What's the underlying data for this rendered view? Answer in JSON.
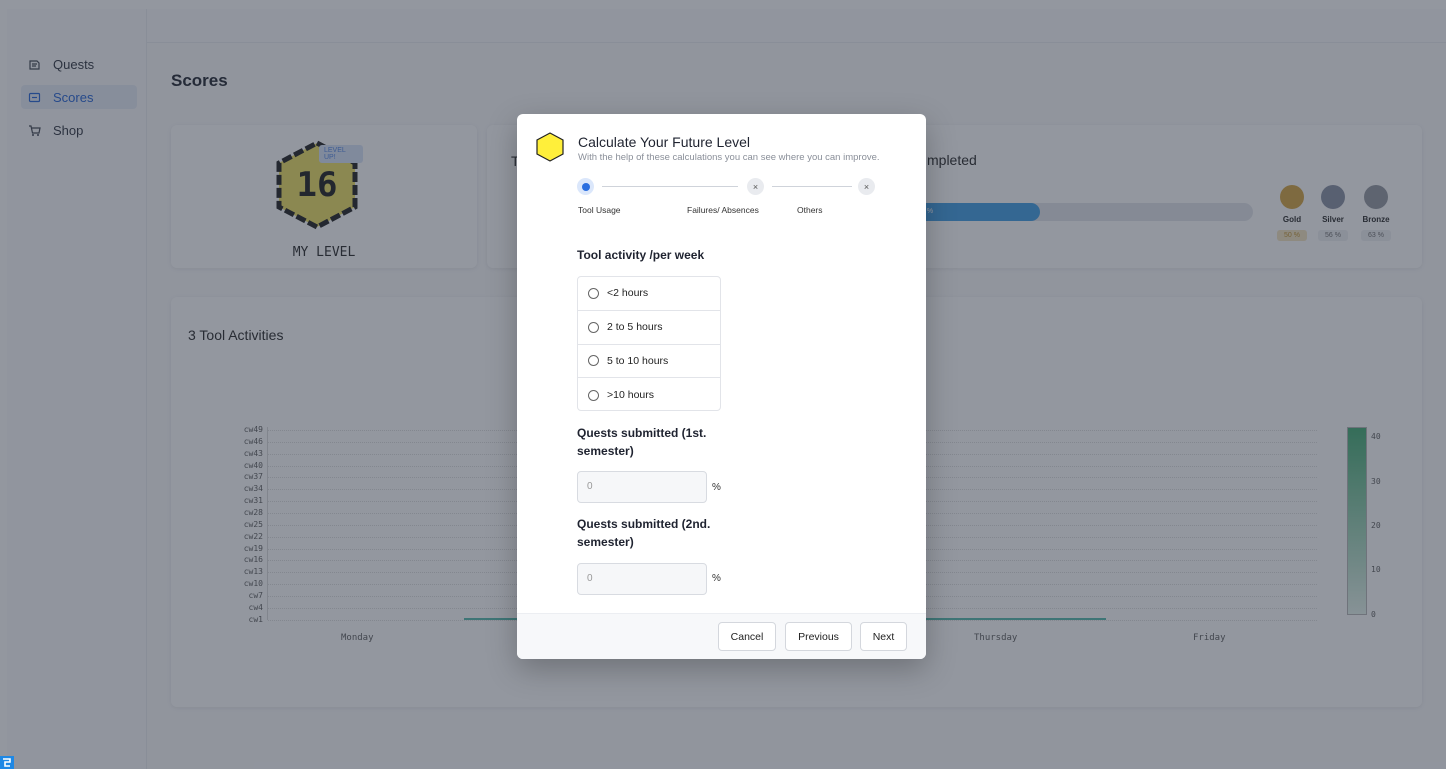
{
  "sidebar": {
    "items": [
      {
        "label": "Quests",
        "icon": "quest-icon"
      },
      {
        "label": "Scores",
        "icon": "scores-icon",
        "active": true
      },
      {
        "label": "Shop",
        "icon": "cart-icon"
      }
    ]
  },
  "page": {
    "title": "Scores"
  },
  "level_card": {
    "pill": "LEVEL UP!",
    "level": "16",
    "caption": "MY LEVEL"
  },
  "mid_card": {
    "label_fragment": "T"
  },
  "completed_card": {
    "title_fragment": "mpleted",
    "sub_fragment": "t",
    "progress_label": "0 %",
    "progress_fraction": 0.37,
    "medals": [
      {
        "name": "Gold",
        "pct": "50 %",
        "color": "#d6a94a"
      },
      {
        "name": "Silver",
        "pct": "56 %",
        "color": "#8f96a8"
      },
      {
        "name": "Bronze",
        "pct": "63 %",
        "color": "#9a9ea6"
      }
    ]
  },
  "activities": {
    "title": "3 Tool Activities",
    "y_labels": [
      "cw49",
      "cw46",
      "cw43",
      "cw40",
      "cw37",
      "cw34",
      "cw31",
      "cw28",
      "cw25",
      "cw22",
      "cw19",
      "cw16",
      "cw13",
      "cw10",
      "cw7",
      "cw4",
      "cw1"
    ],
    "x_labels": [
      "Monday",
      "Thursday",
      "Friday"
    ],
    "scale_labels": [
      "40",
      "30",
      "20",
      "10",
      "0"
    ]
  },
  "modal": {
    "title": "Calculate Your Future Level",
    "subtitle": "With the help of these calculations you can see where you can improve.",
    "steps": [
      {
        "label": "Tool Usage",
        "state": "active"
      },
      {
        "label": "Failures/ Absences",
        "state": "todo",
        "mark": "×"
      },
      {
        "label": "Others",
        "state": "todo",
        "mark": "×"
      }
    ],
    "tool_activity": {
      "title": "Tool activity /per week",
      "options": [
        "<2 hours",
        "2 to 5 hours",
        "5 to 10 hours",
        ">10 hours"
      ]
    },
    "quests_1": {
      "title": "Quests submitted (1st. semester)",
      "placeholder": "0",
      "unit": "%"
    },
    "quests_2": {
      "title": "Quests submitted (2nd. semester)",
      "placeholder": "0",
      "unit": "%"
    },
    "buttons": {
      "cancel": "Cancel",
      "previous": "Previous",
      "next": "Next"
    }
  },
  "colors": {
    "accent": "#2b6fe0",
    "badge_yellow": "#f0e36a",
    "overlay": "rgba(30,38,55,0.48)"
  }
}
